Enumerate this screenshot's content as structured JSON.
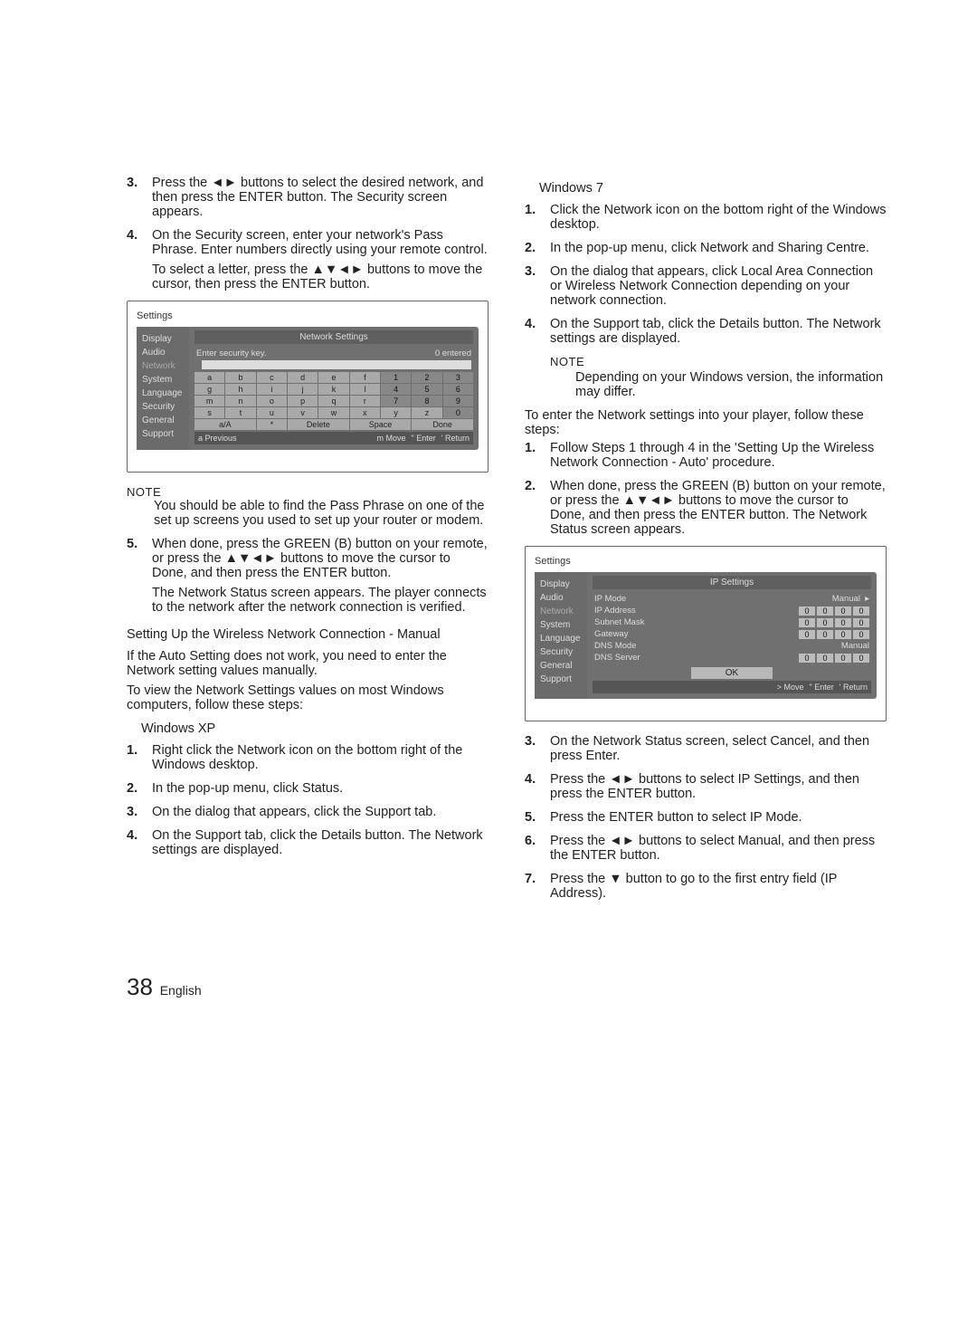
{
  "left": {
    "step3": {
      "num": "3.",
      "text": "Press the ◄► buttons to select the desired network, and then press the ENTER button. The Security screen appears."
    },
    "step4": {
      "num": "4.",
      "text": "On the Security screen, enter your network's Pass Phrase. Enter numbers directly using your remote control.",
      "sub": "To select a letter, press the ▲▼◄► buttons to move the cursor, then press the ENTER button."
    },
    "ui1": {
      "title": "Settings",
      "headline": "Network Settings",
      "side": [
        "Display",
        "Audio",
        "Network",
        "System",
        "Language",
        "Security",
        "General",
        "Support"
      ],
      "prompt": "Enter security key.",
      "counter": "0 entered",
      "keys_r1": [
        "a",
        "b",
        "c",
        "d",
        "e",
        "f",
        "1",
        "2",
        "3"
      ],
      "keys_r2": [
        "g",
        "h",
        "i",
        "j",
        "k",
        "l",
        "4",
        "5",
        "6"
      ],
      "keys_r3": [
        "m",
        "n",
        "o",
        "p",
        "q",
        "r",
        "7",
        "8",
        "9"
      ],
      "keys_r4": [
        "s",
        "t",
        "u",
        "v",
        "w",
        "x",
        "y",
        "z",
        "0"
      ],
      "keys_r5": [
        "a/A",
        "*",
        "Delete",
        "Space",
        "Done"
      ],
      "foot": [
        "a Previous",
        "m Move",
        "\" Enter",
        "' Return"
      ]
    },
    "note_label": "NOTE",
    "note_body": "You should be able to find the Pass Phrase on one of the set up screens you used to set up your router or modem.",
    "step5": {
      "num": "5.",
      "text": "When done, press the GREEN (B) button on your remote, or press the ▲▼◄► buttons to move the cursor to Done, and then press the ENTER button.",
      "sub": "The Network Status screen appears. The player connects to the network after the network connection is verified."
    },
    "h_manual": "Setting Up the Wireless Network Connection - Manual",
    "manual_p1": "If the Auto Setting does not work, you need to enter the Network setting values manually.",
    "manual_p2": "To view the Network Settings values on most Windows computers, follow these steps:",
    "winxp": "Windows XP",
    "xp1": {
      "num": "1.",
      "text": "Right click the Network icon on the bottom right of the Windows desktop."
    },
    "xp2": {
      "num": "2.",
      "text": "In the pop-up menu, click Status."
    },
    "xp3": {
      "num": "3.",
      "text": "On the dialog that appears, click the Support tab."
    },
    "xp4": {
      "num": "4.",
      "text": "On the Support tab, click the Details button. The Network settings are displayed."
    }
  },
  "right": {
    "win7": "Windows 7",
    "w71": {
      "num": "1.",
      "text": "Click the Network icon on the bottom right of the Windows desktop."
    },
    "w72": {
      "num": "2.",
      "text": "In the pop-up menu, click Network and Sharing Centre."
    },
    "w73": {
      "num": "3.",
      "text": "On the dialog that appears, click Local Area Connection or Wireless Network Connection depending on your network connection."
    },
    "w74": {
      "num": "4.",
      "text": "On the Support tab, click the Details button. The Network settings are displayed."
    },
    "note_label": "NOTE",
    "note_body": "Depending on your Windows version, the information may differ.",
    "enter_p": "To enter the Network settings into your player, follow these steps:",
    "e1": {
      "num": "1.",
      "text": "Follow Steps 1 through 4 in the 'Setting Up the Wireless Network Connection - Auto' procedure."
    },
    "e2": {
      "num": "2.",
      "text": "When done, press the GREEN (B) button on your remote, or press the ▲▼◄► buttons to move the cursor to Done, and then press the ENTER button. The Network Status screen appears."
    },
    "ui2": {
      "title": "Settings",
      "headline": "IP Settings",
      "side": [
        "Display",
        "Audio",
        "Network",
        "System",
        "Language",
        "Security",
        "General",
        "Support"
      ],
      "rows": [
        {
          "label": "IP Mode",
          "val": "Manual",
          "arrow": true
        },
        {
          "label": "IP Address",
          "ip": [
            "0",
            "0",
            "0",
            "0"
          ]
        },
        {
          "label": "Subnet Mask",
          "ip": [
            "0",
            "0",
            "0",
            "0"
          ]
        },
        {
          "label": "Gateway",
          "ip": [
            "0",
            "0",
            "0",
            "0"
          ]
        },
        {
          "label": "DNS Mode",
          "val": "Manual"
        },
        {
          "label": "DNS Server",
          "ip": [
            "0",
            "0",
            "0",
            "0"
          ]
        }
      ],
      "ok": "OK",
      "foot": [
        "> Move",
        "\" Enter",
        "' Return"
      ]
    },
    "e3": {
      "num": "3.",
      "text": "On the Network Status screen, select Cancel, and then press Enter."
    },
    "e4": {
      "num": "4.",
      "text": "Press the ◄► buttons to select IP Settings, and then press the ENTER button."
    },
    "e5": {
      "num": "5.",
      "text": "Press the ENTER button to select IP Mode."
    },
    "e6": {
      "num": "6.",
      "text": "Press the ◄► buttons to select Manual, and then press the ENTER button."
    },
    "e7": {
      "num": "7.",
      "text": "Press the ▼ button to go to the first entry field (IP Address)."
    }
  },
  "footer": {
    "page": "38",
    "lang": "English"
  }
}
